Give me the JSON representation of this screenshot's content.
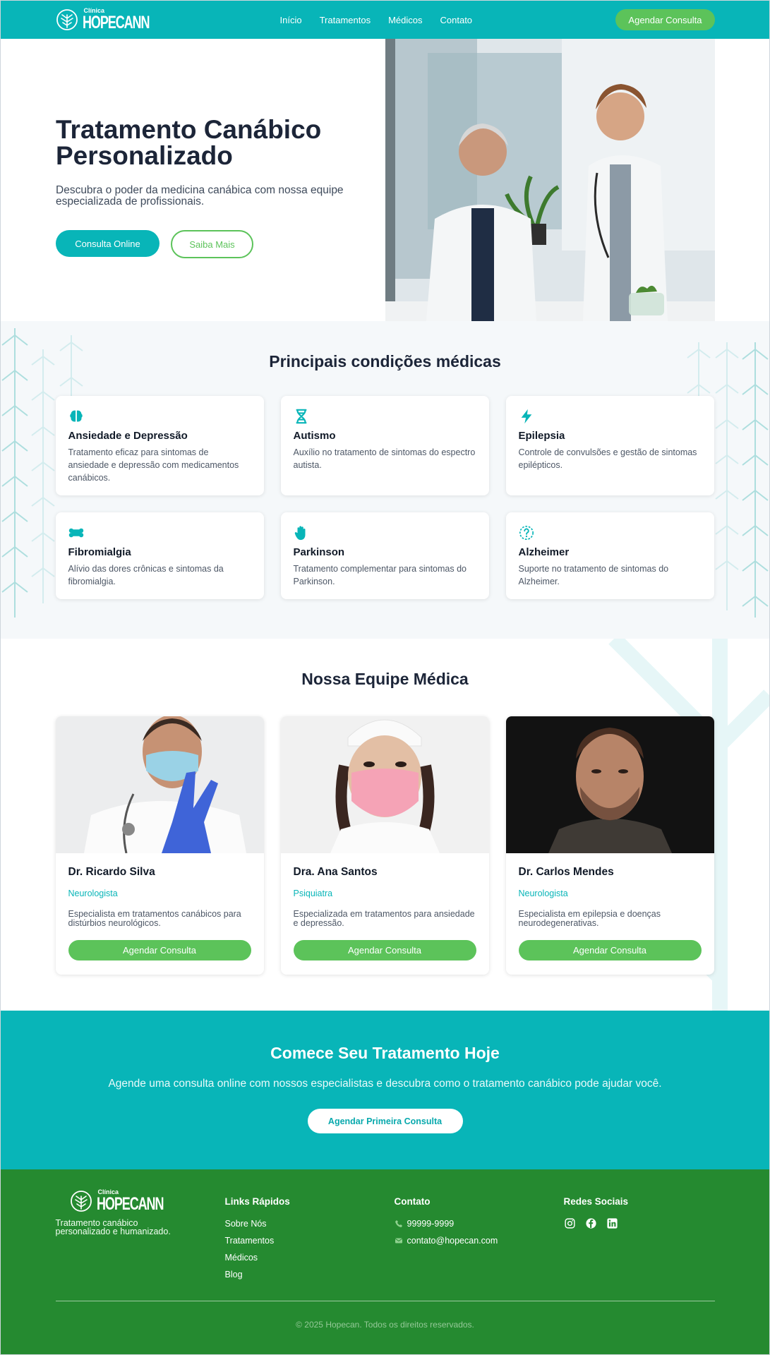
{
  "header": {
    "logo_small": "Clínica",
    "logo_big": "HOPECANN",
    "nav": [
      "Início",
      "Tratamentos",
      "Médicos",
      "Contato"
    ],
    "cta_label": "Agendar Consulta"
  },
  "hero": {
    "title_line1": "Tratamento Canábico",
    "title_line2": "Personalizado",
    "subtitle_line1": "Descubra o poder da medicina canábica com nossa equipe",
    "subtitle_line2": "especializada de profissionais.",
    "primary_button": "Consulta Online",
    "secondary_button": "Saiba Mais"
  },
  "conditions": {
    "title": "Principais condições médicas",
    "items": [
      {
        "icon": "brain-icon",
        "title": "Ansiedade e Depressão",
        "desc": "Tratamento eficaz para sintomas de ansiedade e depressão com medicamentos canábicos."
      },
      {
        "icon": "dna-icon",
        "title": "Autismo",
        "desc": "Auxílio no tratamento de sintomas do espectro autista."
      },
      {
        "icon": "bolt-icon",
        "title": "Epilepsia",
        "desc": "Controle de convulsões e gestão de sintomas epilépticos."
      },
      {
        "icon": "bone-icon",
        "title": "Fibromialgia",
        "desc": "Alívio das dores crônicas e sintomas da fibromialgia."
      },
      {
        "icon": "hand-icon",
        "title": "Parkinson",
        "desc": "Tratamento complementar para sintomas do Parkinson."
      },
      {
        "icon": "question-icon",
        "title": "Alzheimer",
        "desc": "Suporte no tratamento de sintomas do Alzheimer."
      }
    ]
  },
  "team": {
    "title": "Nossa Equipe Médica",
    "doctors": [
      {
        "name": "Dr. Ricardo Silva",
        "specialty": "Neurologista",
        "desc": "Especialista em tratamentos canábicos para distúrbios neurológicos.",
        "button": "Agendar Consulta"
      },
      {
        "name": "Dra. Ana Santos",
        "specialty": "Psiquiatra",
        "desc": "Especializada em tratamentos para ansiedade e depressão.",
        "button": "Agendar Consulta"
      },
      {
        "name": "Dr. Carlos Mendes",
        "specialty": "Neurologista",
        "desc": "Especialista em epilepsia e doenças neurodegenerativas.",
        "button": "Agendar Consulta"
      }
    ]
  },
  "cta": {
    "title": "Comece Seu Tratamento Hoje",
    "subtitle": "Agende uma consulta online com nossos especialistas e descubra como o tratamento canábico pode ajudar você.",
    "button": "Agendar Primeira Consulta"
  },
  "footer": {
    "tagline_line1": "Tratamento canábico",
    "tagline_line2": "personalizado e humanizado.",
    "links_title": "Links Rápidos",
    "links": [
      "Sobre Nós",
      "Tratamentos",
      "Médicos",
      "Blog"
    ],
    "contact_title": "Contato",
    "phone": "99999-9999",
    "email": "contato@hopecan.com",
    "social_title": "Redes Sociais",
    "socials": [
      "instagram-icon",
      "facebook-icon",
      "linkedin-icon"
    ],
    "copyright": "© 2025 Hopecan. Todos os direitos reservados."
  },
  "colors": {
    "teal": "#08b5b8",
    "green": "#5cc35a",
    "footer_green": "#258a30",
    "dark_text": "#1c2538"
  }
}
